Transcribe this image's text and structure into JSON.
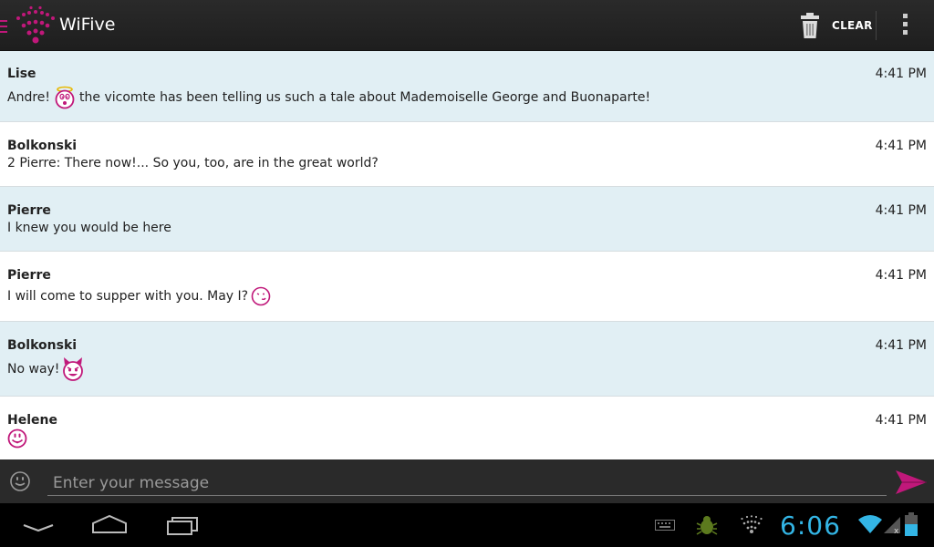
{
  "app": {
    "title": "WiFive"
  },
  "actionbar": {
    "clear_label": "CLEAR"
  },
  "messages": [
    {
      "sender": "Lise",
      "time": "4:41 PM",
      "before": "Andre!",
      "emoticon": "angel-smiley-icon",
      "after": "the vicomte has been telling us such a tale about Mademoiselle George and Buonaparte!"
    },
    {
      "sender": "Bolkonski",
      "time": "4:41 PM",
      "before": "2 Pierre: There now!... So you, too, are in the great world?",
      "emoticon": "",
      "after": ""
    },
    {
      "sender": "Pierre",
      "time": "4:41 PM",
      "before": "I knew you would be here",
      "emoticon": "",
      "after": ""
    },
    {
      "sender": "Pierre",
      "time": "4:41 PM",
      "before": "I will come to supper with you. May I?",
      "emoticon": "wink-smiley-icon",
      "after": ""
    },
    {
      "sender": "Bolkonski",
      "time": "4:41 PM",
      "before": "No way!",
      "emoticon": "devil-smiley-icon",
      "after": ""
    },
    {
      "sender": "Helene",
      "time": "4:41 PM",
      "before": "",
      "emoticon": "tongue-smiley-icon",
      "after": ""
    }
  ],
  "input": {
    "placeholder": "Enter your message"
  },
  "status": {
    "clock": "6:06"
  },
  "colors": {
    "accent": "#c0187a",
    "clock": "#33b5e5",
    "row_alt": "#e1eff4"
  }
}
